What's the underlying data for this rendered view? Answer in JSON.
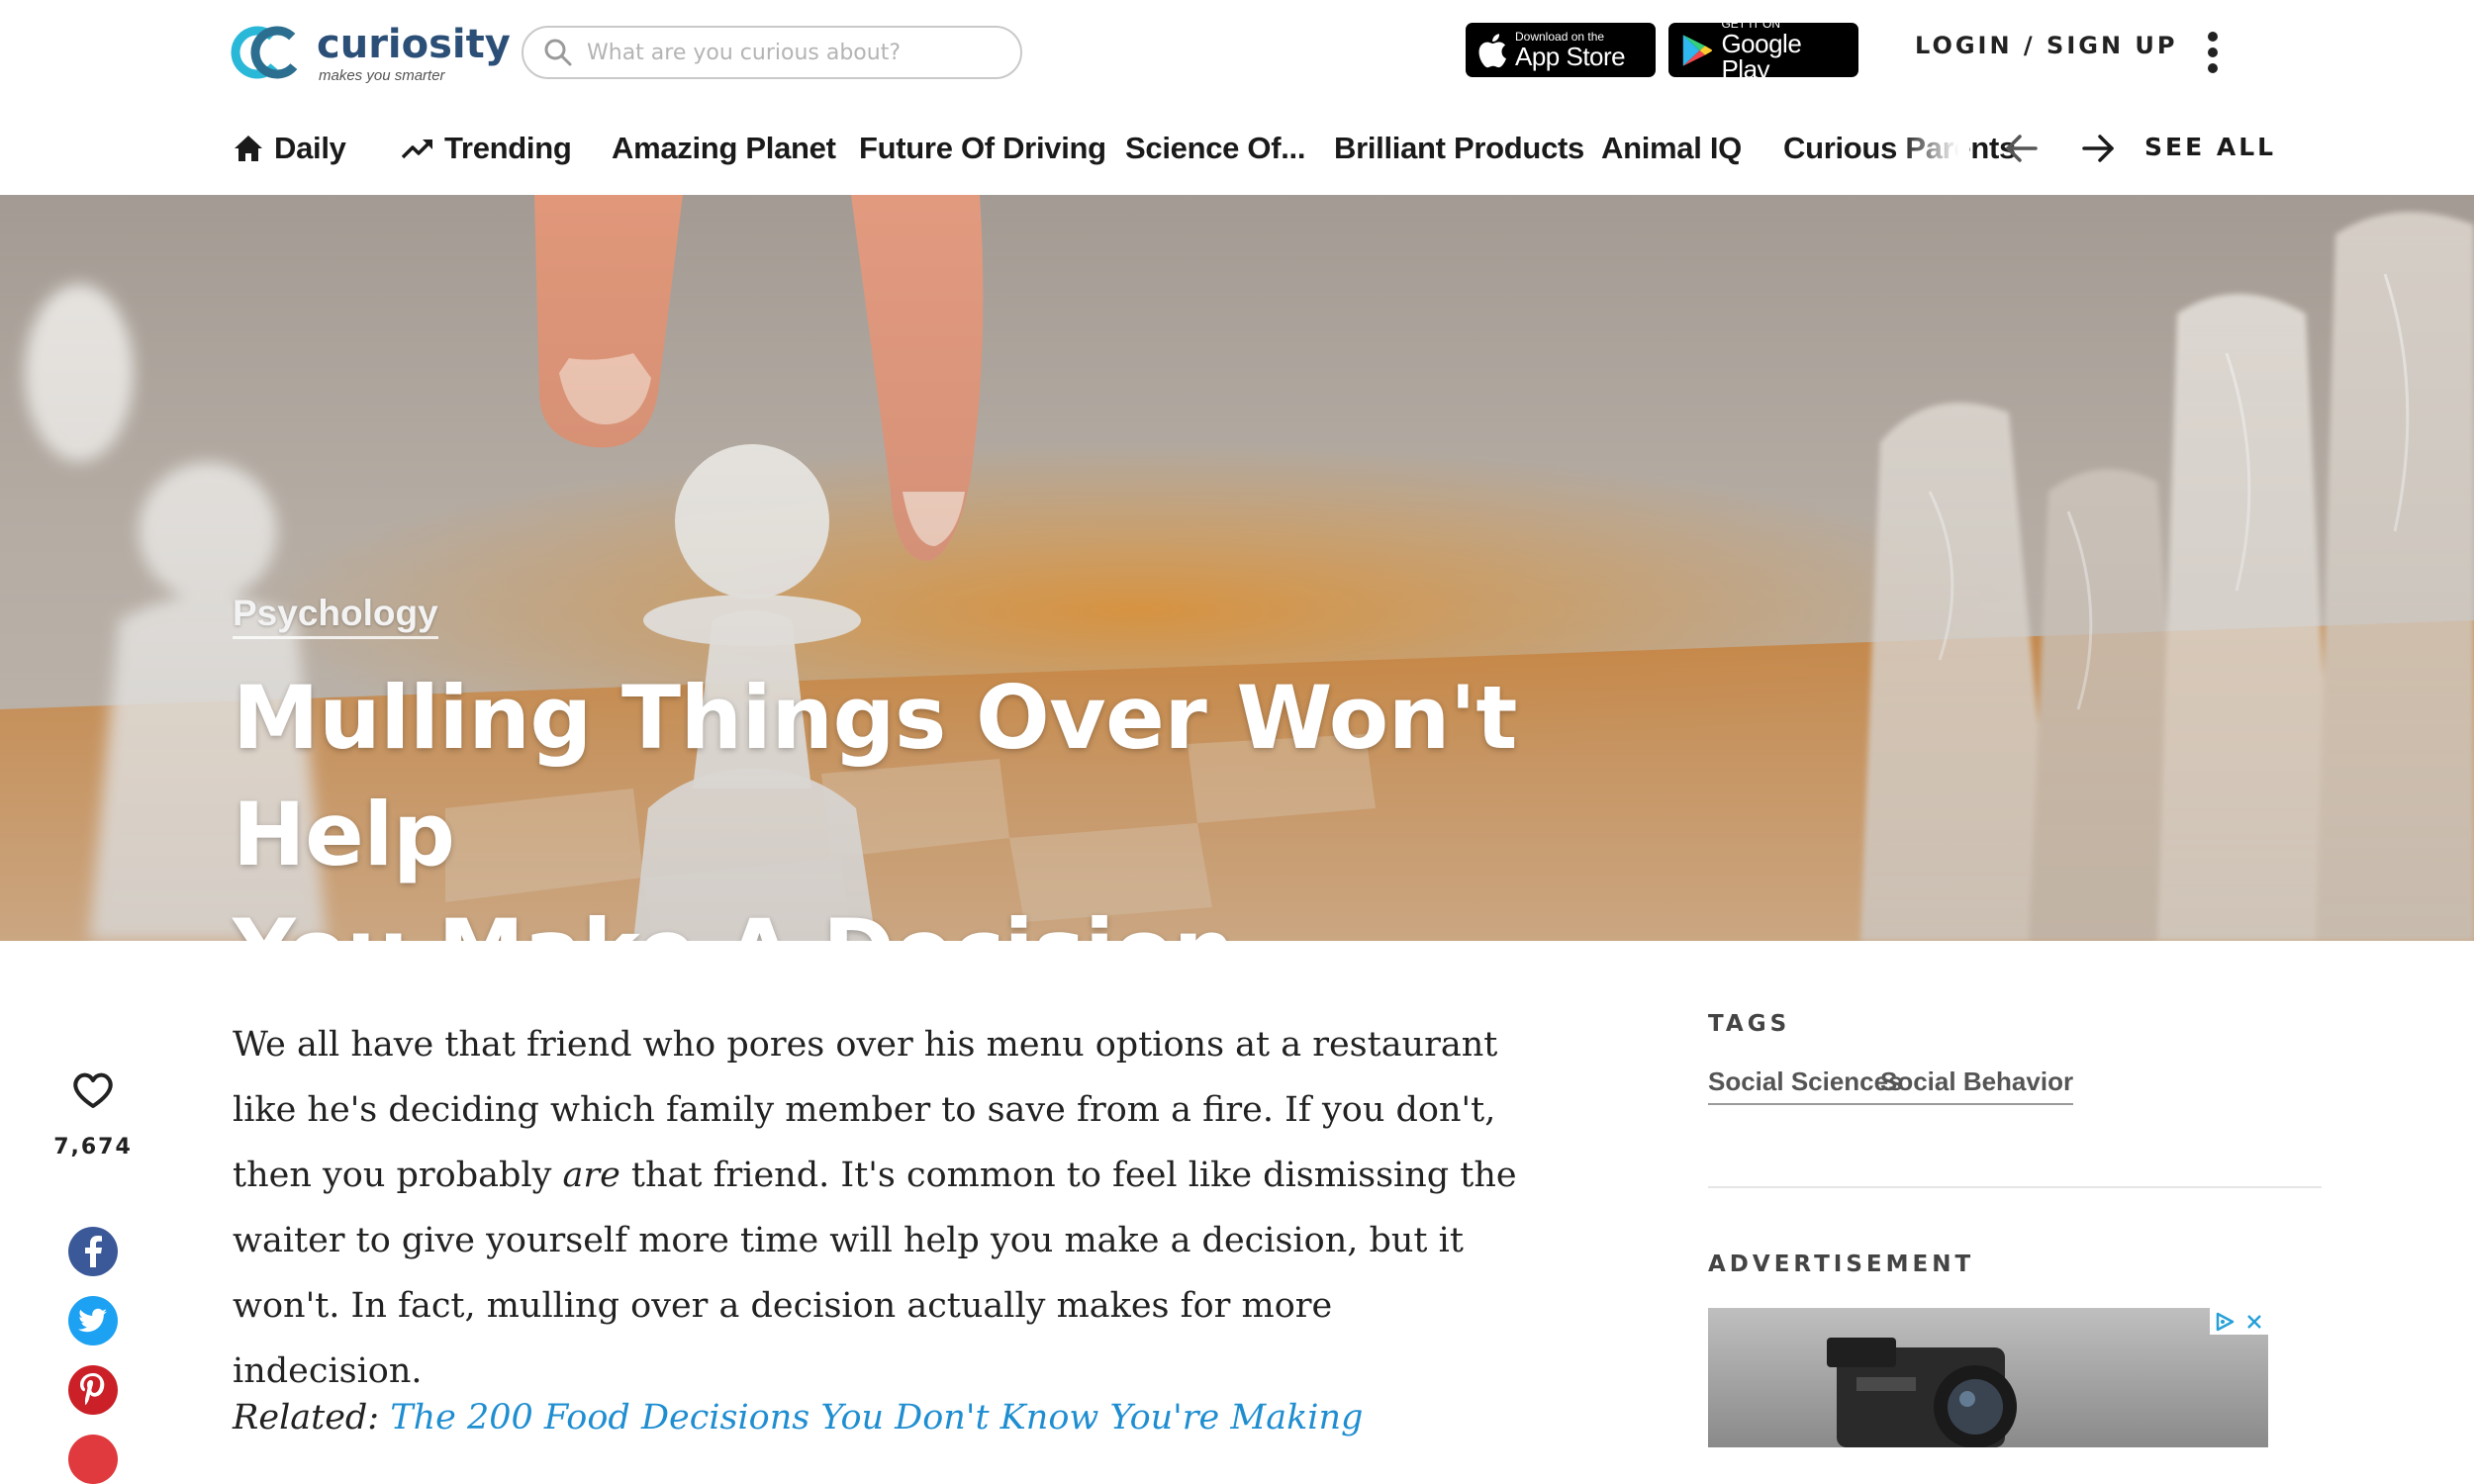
{
  "brand": {
    "name": "curiosity",
    "tagline": "makes you smarter",
    "accent_color": "#29b8d8"
  },
  "header": {
    "search_placeholder": "What are you curious about?",
    "app_store": {
      "small": "Download on the",
      "big": "App Store"
    },
    "google_play": {
      "small": "GET IT ON",
      "big": "Google Play"
    },
    "login_label": "LOGIN / SIGN UP",
    "menu_icon": "kebab-icon"
  },
  "nav": {
    "items": [
      {
        "label": "Daily",
        "icon": "home-icon"
      },
      {
        "label": "Trending",
        "icon": "trending-icon"
      },
      {
        "label": "Amazing Planet"
      },
      {
        "label": "Future Of Driving"
      },
      {
        "label": "Science Of..."
      },
      {
        "label": "Brilliant Products"
      },
      {
        "label": "Animal IQ"
      },
      {
        "label": "Curious Parents"
      }
    ],
    "see_all": "SEE ALL"
  },
  "hero": {
    "category": "Psychology",
    "title_line1": "Mulling Things Over Won't Help",
    "title_line2": "You Make A Decision"
  },
  "share": {
    "like_count": "7,674",
    "networks": [
      "facebook-icon",
      "twitter-icon",
      "pinterest-icon"
    ]
  },
  "article": {
    "p1_before": "We all have that friend who pores over his menu options at a restaurant like he's deciding which family member to save from a fire. If you don't, then you probably ",
    "p1_em": "are",
    "p1_after": " that friend. It's common to feel like dismissing the waiter to give yourself more time will help you make a decision, but it won't. In fact, mulling over a decision actually makes for more indecision.",
    "related_label": "Related:",
    "related_link": "The 200 Food Decisions You Don't Know You're Making",
    "link_color": "#1f8ed1"
  },
  "sidebar": {
    "tags_heading": "TAGS",
    "tags": [
      "Social Sciences",
      "Social Behavior"
    ],
    "ad_heading": "ADVERTISEMENT"
  }
}
